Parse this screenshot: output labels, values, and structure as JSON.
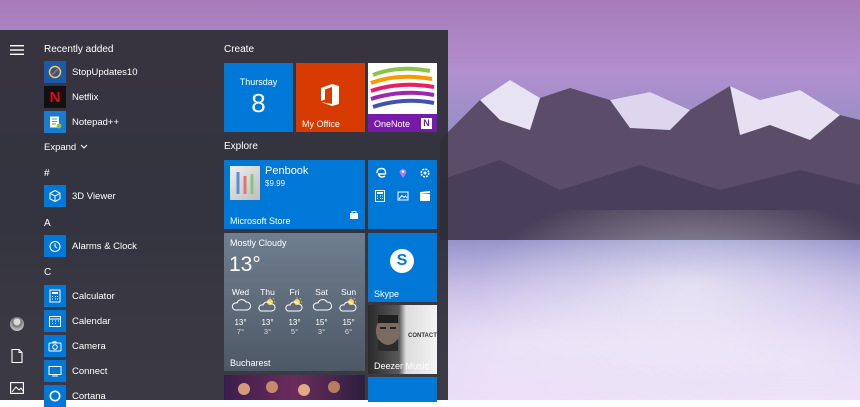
{
  "colors": {
    "accent": "#0078d7",
    "office_orange": "#d83b01",
    "panel": "#2c2c34"
  },
  "left_list": {
    "recently_added_title": "Recently added",
    "recent": [
      {
        "label": "StopUpdates10",
        "icon": "stop-updates-icon"
      },
      {
        "label": "Netflix",
        "icon": "netflix-icon"
      },
      {
        "label": "Notepad++",
        "icon": "notepadpp-icon"
      }
    ],
    "expand_label": "Expand",
    "sections": [
      {
        "letter": "#",
        "apps": [
          {
            "label": "3D Viewer",
            "icon": "cube-icon"
          }
        ]
      },
      {
        "letter": "A",
        "apps": [
          {
            "label": "Alarms & Clock",
            "icon": "alarm-clock-icon"
          }
        ]
      },
      {
        "letter": "C",
        "apps": [
          {
            "label": "Calculator",
            "icon": "calculator-icon"
          },
          {
            "label": "Calendar",
            "icon": "calendar-icon"
          },
          {
            "label": "Camera",
            "icon": "camera-icon"
          },
          {
            "label": "Connect",
            "icon": "connect-icon"
          },
          {
            "label": "Cortana",
            "icon": "cortana-icon"
          }
        ]
      }
    ]
  },
  "tiles": {
    "create_title": "Create",
    "explore_title": "Explore",
    "calendar": {
      "day": "Thursday",
      "date": "8"
    },
    "office": {
      "label": "My Office"
    },
    "onenote": {
      "label": "OneNote"
    },
    "store": {
      "app": "Penbook",
      "price": "$9.99",
      "label": "Microsoft Store"
    },
    "weather": {
      "condition": "Mostly Cloudy",
      "temp": "13°",
      "days": [
        {
          "day": "Wed",
          "hi": "13°",
          "lo": "7°"
        },
        {
          "day": "Thu",
          "hi": "13°",
          "lo": "3°"
        },
        {
          "day": "Fri",
          "hi": "13°",
          "lo": "5°"
        },
        {
          "day": "Sat",
          "hi": "15°",
          "lo": "3°"
        },
        {
          "day": "Sun",
          "hi": "15°",
          "lo": "6°"
        }
      ],
      "city": "Bucharest"
    },
    "skype": {
      "label": "Skype"
    },
    "deezer": {
      "label": "Deezer Music",
      "brand": "CONTACT"
    }
  }
}
